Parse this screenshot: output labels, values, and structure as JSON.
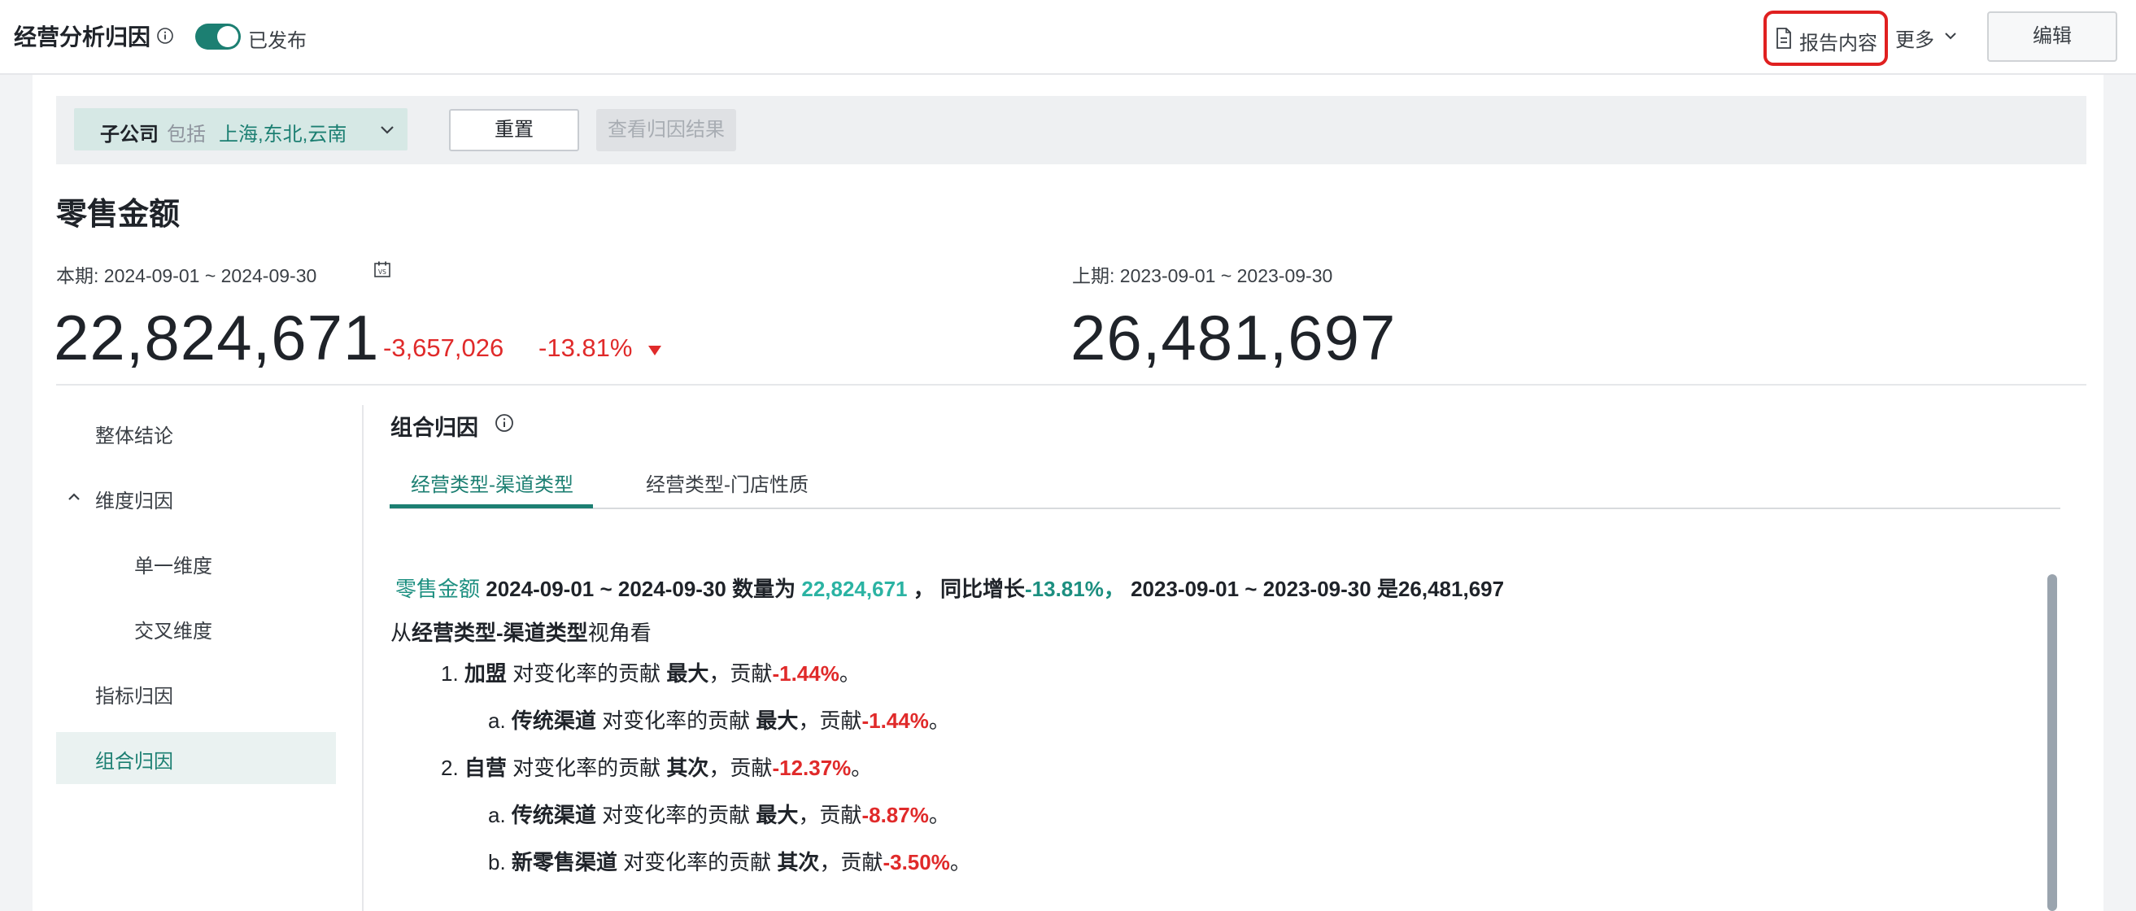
{
  "header": {
    "title": "经营分析归因",
    "publish_status": "已发布",
    "report_label": "报告内容",
    "more_label": "更多",
    "edit_label": "编辑"
  },
  "filter": {
    "key": "子公司",
    "operator": "包括",
    "values": "上海,东北,云南",
    "reset_label": "重置",
    "view_result_label": "查看归因结果"
  },
  "metric": {
    "title": "零售金额",
    "current_period": "本期: 2024-09-01 ~ 2024-09-30",
    "current_value": "22,824,671",
    "delta_abs": "-3,657,026",
    "delta_pct": "-13.81%",
    "previous_period": "上期: 2023-09-01 ~ 2023-09-30",
    "previous_value": "26,481,697"
  },
  "nav": {
    "items": [
      {
        "label": "整体结论"
      },
      {
        "label": "维度归因"
      },
      {
        "label": "单一维度"
      },
      {
        "label": "交叉维度"
      },
      {
        "label": "指标归因"
      },
      {
        "label": "组合归因"
      }
    ]
  },
  "content": {
    "section_title": "组合归因",
    "tabs": [
      {
        "label": "经营类型-渠道类型"
      },
      {
        "label": "经营类型-门店性质"
      }
    ],
    "summary": {
      "metric": "零售金额",
      "period": "2024-09-01 ~ 2024-09-30",
      "qty_label": "数量为",
      "qty_value": "22,824,671",
      "sep": "，",
      "growth_label": "同比增长",
      "growth_value": "-13.81%，",
      "prev_period": "2023-09-01 ~ 2023-09-30",
      "is_label": "是",
      "prev_value": "26,481,697"
    },
    "perspective": {
      "prefix": "从",
      "dim": "经营类型-渠道类型",
      "suffix": "视角看"
    },
    "items": [
      {
        "marker": "1.",
        "name": "加盟",
        "mid": "对变化率的贡献",
        "rank": "最大",
        "contrib": "，贡献",
        "value": "-1.44%",
        "end": "。"
      },
      {
        "marker": "a.",
        "name": "传统渠道",
        "mid": "对变化率的贡献",
        "rank": "最大",
        "contrib": "，贡献",
        "value": "-1.44%",
        "end": "。"
      },
      {
        "marker": "2.",
        "name": "自营",
        "mid": "对变化率的贡献",
        "rank": "其次",
        "contrib": "，贡献",
        "value": "-12.37%",
        "end": "。"
      },
      {
        "marker": "a.",
        "name": "传统渠道",
        "mid": "对变化率的贡献",
        "rank": "最大",
        "contrib": "，贡献",
        "value": "-8.87%",
        "end": "。"
      },
      {
        "marker": "b.",
        "name": "新零售渠道",
        "mid": "对变化率的贡献",
        "rank": "其次",
        "contrib": "，贡献",
        "value": "-3.50%",
        "end": "。"
      }
    ]
  },
  "colors": {
    "accent": "#1c7f72",
    "highlight": "#2bb3a3",
    "negative": "#e02a2a",
    "report_outline": "#e02020"
  }
}
